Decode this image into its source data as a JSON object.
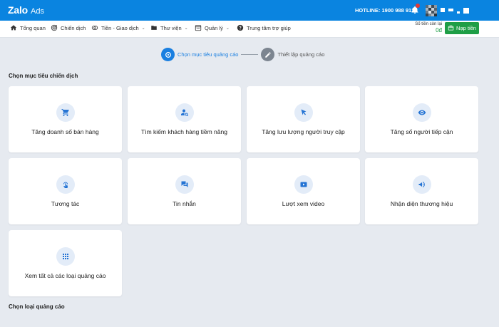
{
  "header": {
    "brand": "Zalo",
    "brand_sub": "Ads",
    "hotline": "HOTLINE: 1900 988 912",
    "colors": {
      "primary": "#0a84e0",
      "success": "#1e9e46"
    }
  },
  "nav": {
    "items": [
      {
        "label": "Tổng quan",
        "icon": "home-icon"
      },
      {
        "label": "Chiến dịch",
        "icon": "target-icon"
      },
      {
        "label": "Tiền - Giao dịch",
        "icon": "money-icon",
        "caret": "⌄"
      },
      {
        "label": "Thư viện",
        "icon": "folder-icon",
        "caret": "⌄"
      },
      {
        "label": "Quản lý",
        "icon": "calendar-icon",
        "caret": "⌄"
      },
      {
        "label": "Trung tâm trợ giúp",
        "icon": "help-icon"
      }
    ],
    "balance_label": "Số tiền còn lại",
    "balance_value": "0đ",
    "topup_label": "Nạp tiền"
  },
  "stepper": {
    "steps": [
      {
        "label": "Chọn mục tiêu quảng cáo",
        "state": "active"
      },
      {
        "label": "Thiết lập quảng cáo",
        "state": "inactive"
      }
    ]
  },
  "objectives": {
    "title": "Chọn mục tiêu chiến dịch",
    "cards": [
      {
        "label": "Tăng doanh số bán hàng",
        "icon": "cart-icon"
      },
      {
        "label": "Tìm kiếm khách hàng tiềm năng",
        "icon": "user-search-icon"
      },
      {
        "label": "Tăng lưu lượng người truy cập",
        "icon": "cursor-icon"
      },
      {
        "label": "Tăng số người tiếp cận",
        "icon": "eye-icon"
      },
      {
        "label": "Tương tác",
        "icon": "touch-icon"
      },
      {
        "label": "Tin nhắn",
        "icon": "chat-icon"
      },
      {
        "label": "Lượt xem video",
        "icon": "video-icon"
      },
      {
        "label": "Nhận diện thương hiệu",
        "icon": "megaphone-icon"
      },
      {
        "label": "Xem tất cả các loại quảng cáo",
        "icon": "grid-icon"
      }
    ]
  },
  "ad_types": {
    "title": "Chọn loại quảng cáo"
  }
}
